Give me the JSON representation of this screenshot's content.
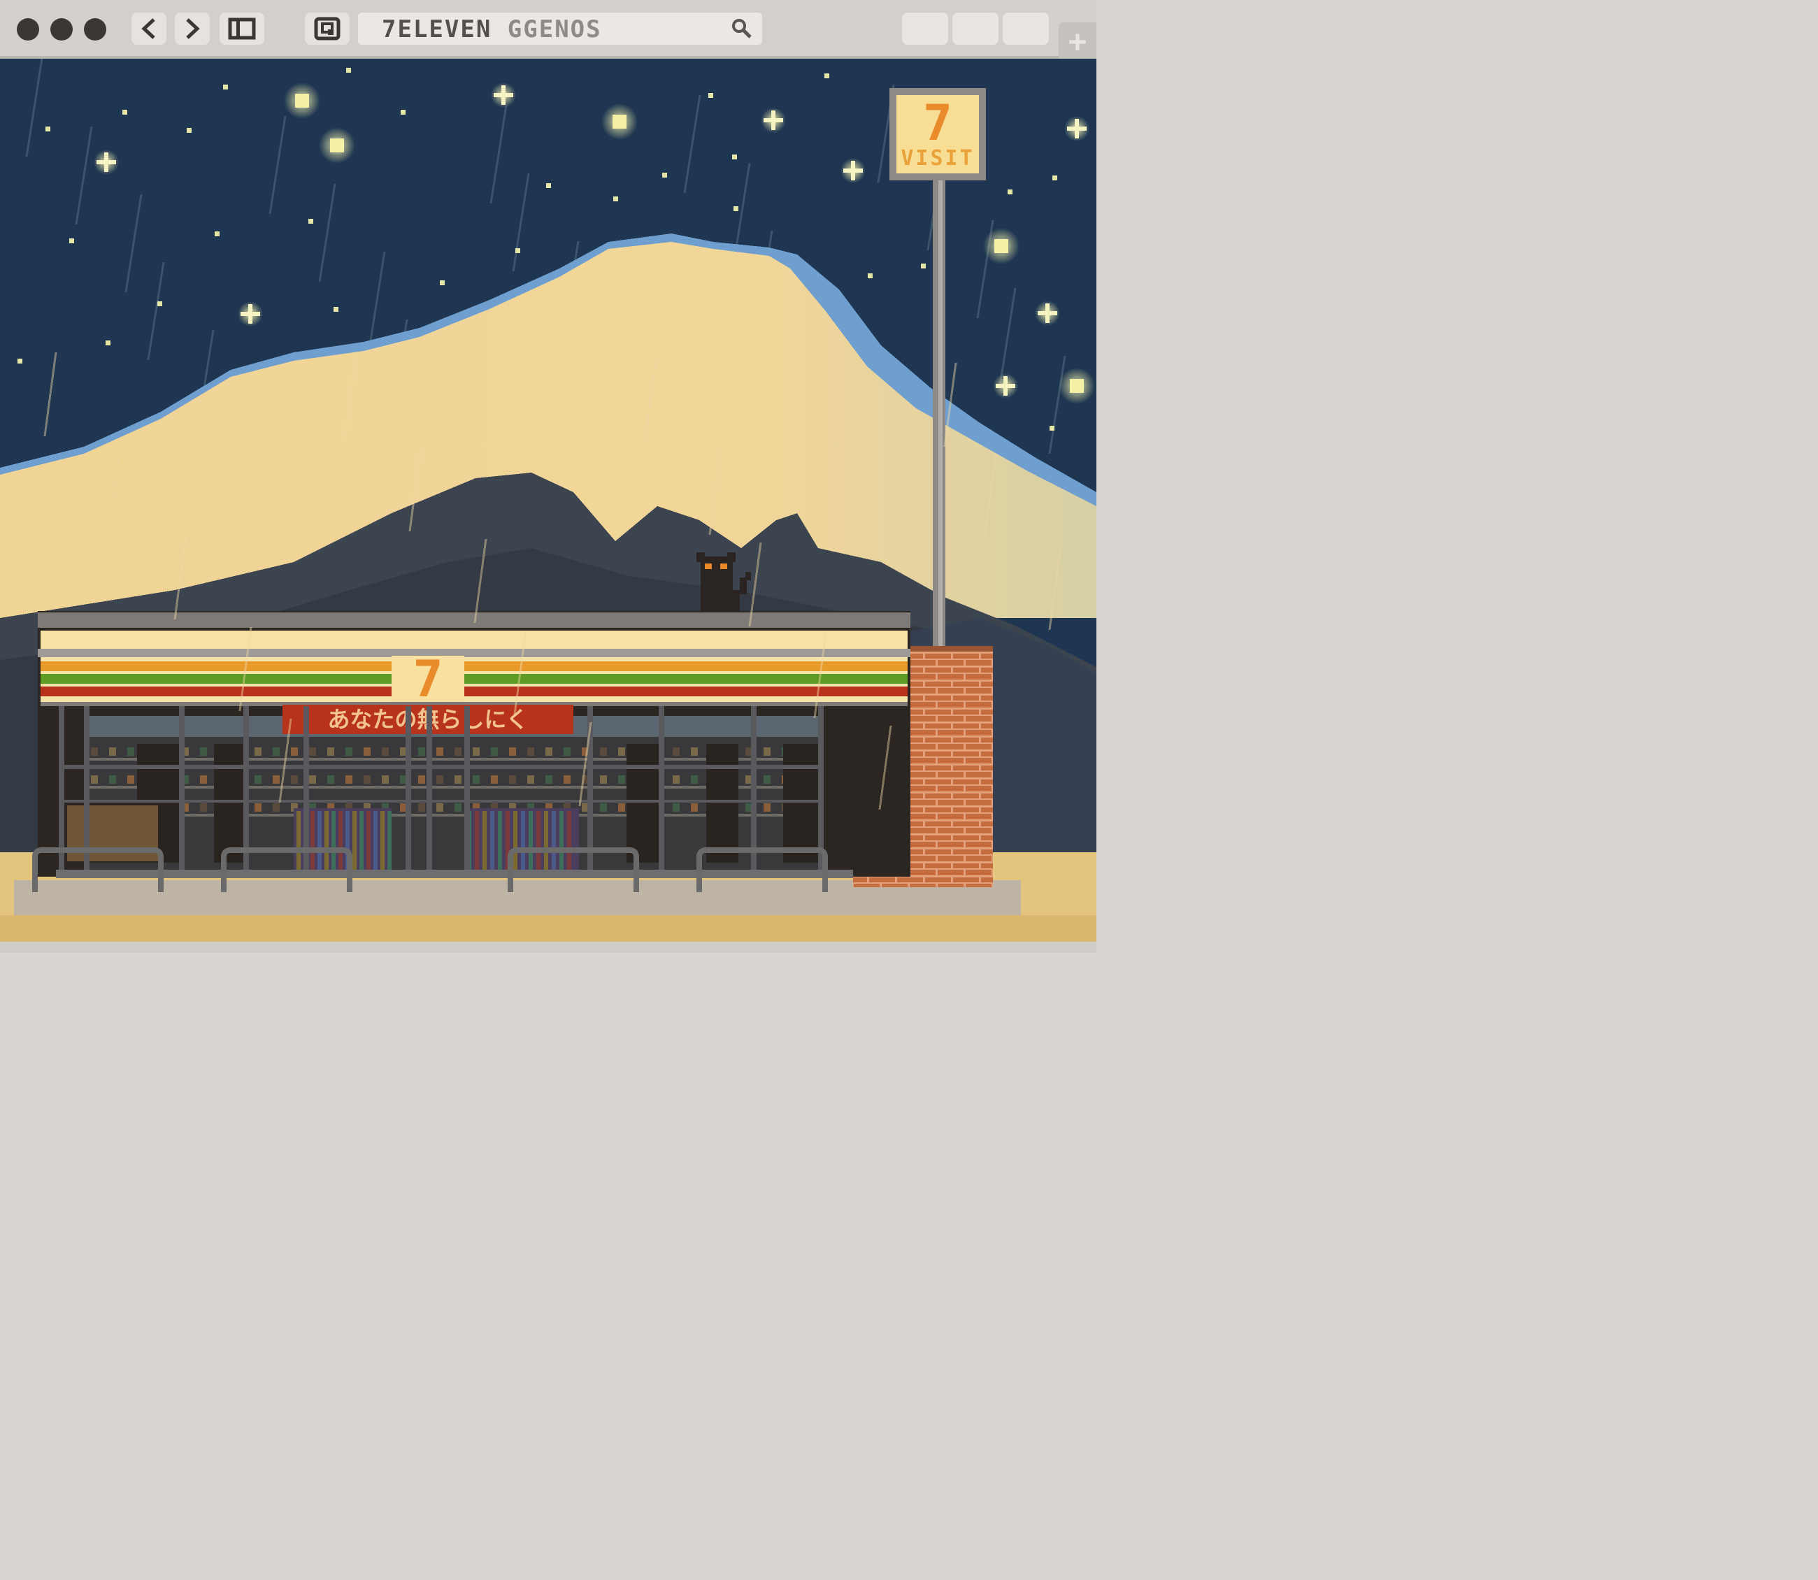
{
  "window": {
    "controls": [
      "close",
      "minimize",
      "zoom"
    ],
    "nav": {
      "back_icon": "chevron-left-icon",
      "forward_icon": "chevron-right-icon",
      "sidebar_icon": "sidebar-icon",
      "share_icon": "share-icon"
    },
    "address_bar": {
      "host": "7ELEVEN",
      "path": "GGENOS",
      "search_icon": "search-icon"
    },
    "new_tab_label": "+"
  },
  "scene": {
    "sign": {
      "logo": "7",
      "text": "VISIT"
    },
    "store_banner": "あなたの無らしにく",
    "colors": {
      "sky": "#1d3650",
      "mountain": "#f1d495",
      "stripe_orange": "#e89a2a",
      "stripe_green": "#5e9b22",
      "stripe_red": "#b8321b",
      "brick": "#c06a3c"
    }
  }
}
